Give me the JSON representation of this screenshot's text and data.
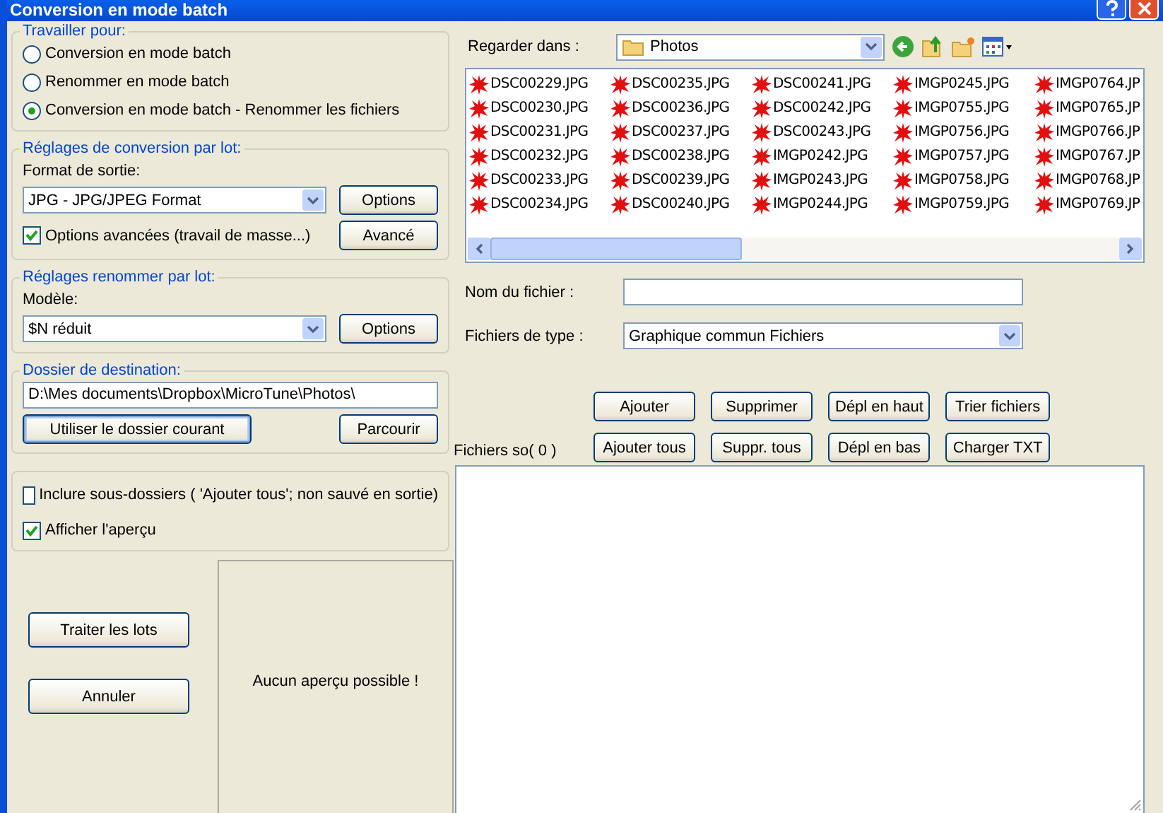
{
  "window": {
    "title": "Conversion en mode batch"
  },
  "work_for": {
    "title": "Travailler pour:",
    "options": [
      {
        "label": "Conversion en mode batch",
        "selected": false
      },
      {
        "label": "Renommer en mode batch",
        "selected": false
      },
      {
        "label": "Conversion en mode batch - Renommer les fichiers",
        "selected": true
      }
    ]
  },
  "conversion": {
    "title": "Réglages de conversion par lot:",
    "format_label": "Format de sortie:",
    "format_value": "JPG - JPG/JPEG Format",
    "options_button": "Options",
    "advanced_checkbox": {
      "label": "Options avancées (travail de masse...)",
      "checked": true
    },
    "advanced_button": "Avancé"
  },
  "rename": {
    "title": "Réglages renommer par lot:",
    "model_label": "Modèle:",
    "model_value": "$N réduit",
    "options_button": "Options"
  },
  "destination": {
    "title": "Dossier de destination:",
    "path": "D:\\Mes documents\\Dropbox\\MicroTune\\Photos\\",
    "current_button": "Utiliser le dossier courant",
    "browse_button": "Parcourir"
  },
  "checkboxes": [
    {
      "label": "Inclure sous-dossiers ( 'Ajouter tous'; non sauvé en sortie)",
      "checked": false
    },
    {
      "label": "Afficher l'aperçu",
      "checked": true
    }
  ],
  "actions": [
    "Traiter les lots",
    "Annuler"
  ],
  "preview": {
    "message": "Aucun aperçu possible !"
  },
  "browser": {
    "look_in_label": "Regarder dans :",
    "folder": "Photos",
    "files": [
      "DSC00229.JPG",
      "DSC00230.JPG",
      "DSC00231.JPG",
      "DSC00232.JPG",
      "DSC00233.JPG",
      "DSC00234.JPG",
      "DSC00235.JPG",
      "DSC00236.JPG",
      "DSC00237.JPG",
      "DSC00238.JPG",
      "DSC00239.JPG",
      "DSC00240.JPG",
      "DSC00241.JPG",
      "DSC00242.JPG",
      "DSC00243.JPG",
      "IMGP0242.JPG",
      "IMGP0243.JPG",
      "IMGP0244.JPG",
      "IMGP0245.JPG",
      "IMGP0755.JPG",
      "IMGP0756.JPG",
      "IMGP0757.JPG",
      "IMGP0758.JPG",
      "IMGP0759.JPG",
      "IMGP0764.JP",
      "IMGP0765.JP",
      "IMGP0766.JP",
      "IMGP0767.JP",
      "IMGP0768.JP",
      "IMGP0769.JP"
    ],
    "filename_label": "Nom du fichier :",
    "filetype_label": "Fichiers de type :",
    "filetype_value": "Graphique commun Fichiers"
  },
  "list_buttons": [
    "Ajouter",
    "Supprimer",
    "Dépl en haut",
    "Trier fichiers",
    "Ajouter tous",
    "Suppr. tous",
    "Dépl en bas",
    "Charger TXT"
  ],
  "selected_files": {
    "label": "Fichiers so( 0 )"
  }
}
